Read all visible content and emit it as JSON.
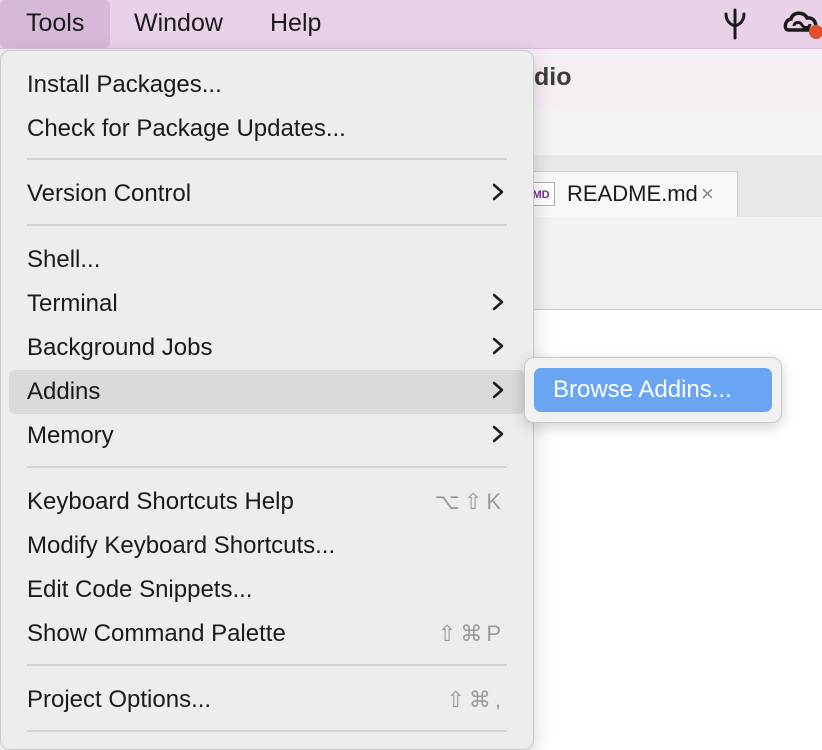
{
  "menubar": {
    "items": [
      {
        "label": "Tools",
        "active": true
      },
      {
        "label": "Window",
        "active": false
      },
      {
        "label": "Help",
        "active": false
      }
    ],
    "tray_icons": [
      "pitchfork-icon",
      "creative-cloud-icon"
    ],
    "colors": {
      "background": "#e9d2e9",
      "active": "#d6b9d6",
      "notification_dot": "#e2502e"
    }
  },
  "background_window": {
    "title_fragment": "dio",
    "open_tab": {
      "icon_text": "MD",
      "label": "README.md",
      "close": "×"
    }
  },
  "menu": {
    "groups": [
      [
        {
          "label": "Install Packages..."
        },
        {
          "label": "Check for Package Updates..."
        }
      ],
      [
        {
          "label": "Version Control",
          "submenu": true
        }
      ],
      [
        {
          "label": "Shell..."
        },
        {
          "label": "Terminal",
          "submenu": true
        },
        {
          "label": "Background Jobs",
          "submenu": true
        },
        {
          "label": "Addins",
          "submenu": true,
          "highlighted": true
        },
        {
          "label": "Memory",
          "submenu": true
        }
      ],
      [
        {
          "label": "Keyboard Shortcuts Help",
          "shortcut": "⌥⇧K"
        },
        {
          "label": "Modify Keyboard Shortcuts..."
        },
        {
          "label": "Edit Code Snippets..."
        },
        {
          "label": "Show Command Palette",
          "shortcut": "⇧⌘P"
        }
      ],
      [
        {
          "label": "Project Options...",
          "shortcut": "⇧⌘,"
        }
      ]
    ],
    "chevron": "›"
  },
  "submenu": {
    "items": [
      {
        "label": "Browse Addins...",
        "highlighted": true
      }
    ],
    "colors": {
      "highlight": "#6aa5f3"
    }
  }
}
